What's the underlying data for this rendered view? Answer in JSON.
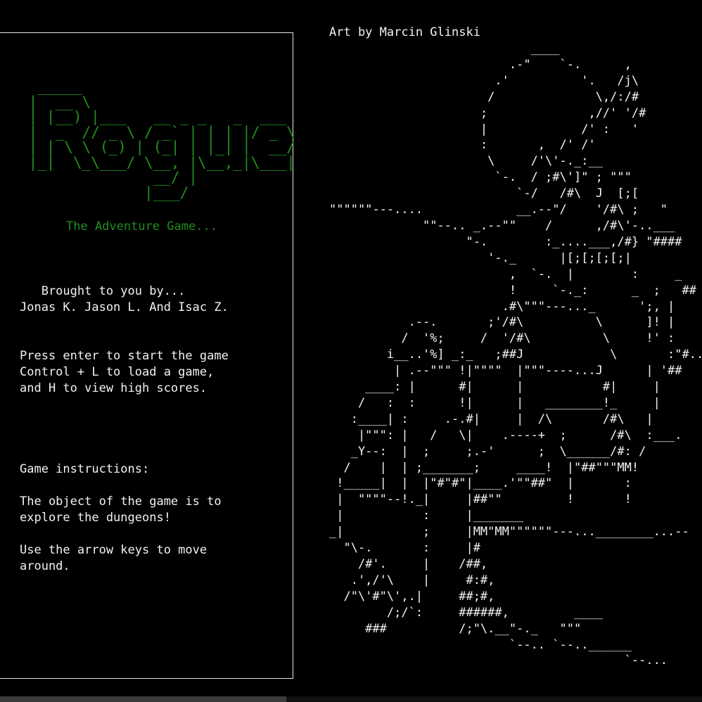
{
  "left_panel": {
    "logo_ascii": "  _____\n |  __ \\\n | |__) |___   __ _ _   _  ___\n |  _  // _ \\ / _` | | | |/ _ \\\n | | \\ \\ (_) | (_| | |_| |  __/\n |_|  \\_\\___/ \\__, |\\__,_|\\___|\n               __/ |\n              |___/",
    "subtitle": "The Adventure Game...",
    "credits": "   Brought to you by...\nJonas K. Jason L. And Isac Z.",
    "controls": "Press enter to start the game\nControl + L to load a game,\nand H to view high scores.",
    "instructions": "Game instructions:\n\nThe object of the game is to\nexplore the dungeons!\n\nUse the arrow keys to move\naround."
  },
  "art": {
    "credit": "Art by Marcin Glinski",
    "castle_ascii": "                            ____\n                         .-\"    `-.      ,\n                       .'          '.   /j\\\n                      /              \\,/:/#\n                     ;              ,//' '/#\n                     |             /' :   '\n                     :       ,  /' /'\n                      \\     /'\\'-._:__\n                       `-.  / ;#\\']\" ; \"\"\"\n                          `-/   /#\\  J  [;[\n\"\"\"\"\"\"---....             __.--\"/    '/#\\ ;   \"\n             \"\"--.. _.--\"\"    /      ,/#\\'-..___\n                   \"-.        :_....___,/#} \"####\n                      '-._      |[;[;[;[;|\n                         ,  `-.  |        :     _\n                         !     `-._:      _  ;   ##\n                        .#\\\"\"\"---..._      ';, |\n           .--.       ;'/#\\          \\      ]! |\n          /  '%;     /  '/#\\          \\     !' :\n        i__..'%] _:_   ;##J            \\       :\"#..\n         | .--\"\"\" !|\"\"\"\"  |\"\"\"----...J      | '##\n     ____: |      #|      |           #|     |\n    /   :  :      !|      |   ________!_     |\n   :____| :     .-.#|     |  /\\       /#\\   |\n    |\"\"\": |   /   \\|    .----+  ;      /#\\  :___.\n   _Y--:  |  ;     ;.-'      ;  \\______/#: /\n  /    |  | ;_______;     ____!  |\"##\"\"\"MM!\n !_____|  |  |\"#\"#\"|____.'\"\"##\"  |       :\n |  \"\"\"\"--!._|     |##\"\"         !       !\n |           :     |_______\n_|           ;     |MM\"MM\"\"\"\"\"\"---...________...--\n  \"\\-.       :     |#\n    /#'.     |    /##,\n   .',/'\\    |     #:#,\n  /\"\\'#\"\\',.|     ##;#,\n        /;/`:     ######,         ____\n     ###          /;\"\\.__\"-._   \"\"\"\n                         `--.. `--..______\n                                         `--..."
  }
}
